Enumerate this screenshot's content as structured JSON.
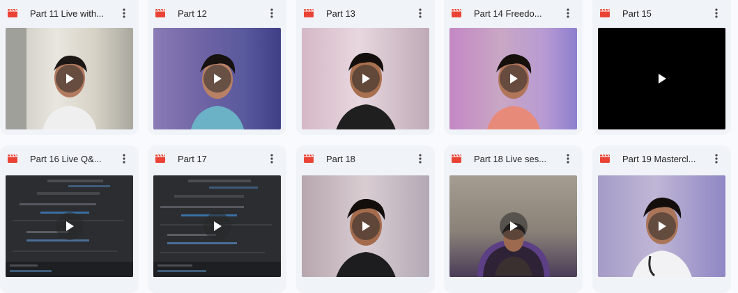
{
  "files": [
    {
      "title": "Part 11 Live with...",
      "type_icon": "video-file-icon",
      "thumb": "video-frame"
    },
    {
      "title": "Part 12",
      "type_icon": "video-file-icon",
      "thumb": "video-frame"
    },
    {
      "title": "Part 13",
      "type_icon": "video-file-icon",
      "thumb": "video-frame"
    },
    {
      "title": "Part 14 Freedo...",
      "type_icon": "video-file-icon",
      "thumb": "video-frame"
    },
    {
      "title": "Part 15",
      "type_icon": "video-file-icon",
      "thumb": "black-frame"
    },
    {
      "title": "Part 16 Live Q&...",
      "type_icon": "video-file-icon",
      "thumb": "software-screen"
    },
    {
      "title": "Part 17",
      "type_icon": "video-file-icon",
      "thumb": "software-screen"
    },
    {
      "title": "Part 18",
      "type_icon": "video-file-icon",
      "thumb": "video-frame"
    },
    {
      "title": "Part 18 Live ses...",
      "type_icon": "video-file-icon",
      "thumb": "video-frame"
    },
    {
      "title": "Part 19 Mastercl...",
      "type_icon": "video-file-icon",
      "thumb": "video-frame"
    }
  ],
  "colors": {
    "video_icon": "#ea4335",
    "card_background": "#f0f4f9",
    "page_background": "#f8fafd"
  },
  "icons": {
    "more": "more-vert-icon",
    "play": "play-icon"
  }
}
